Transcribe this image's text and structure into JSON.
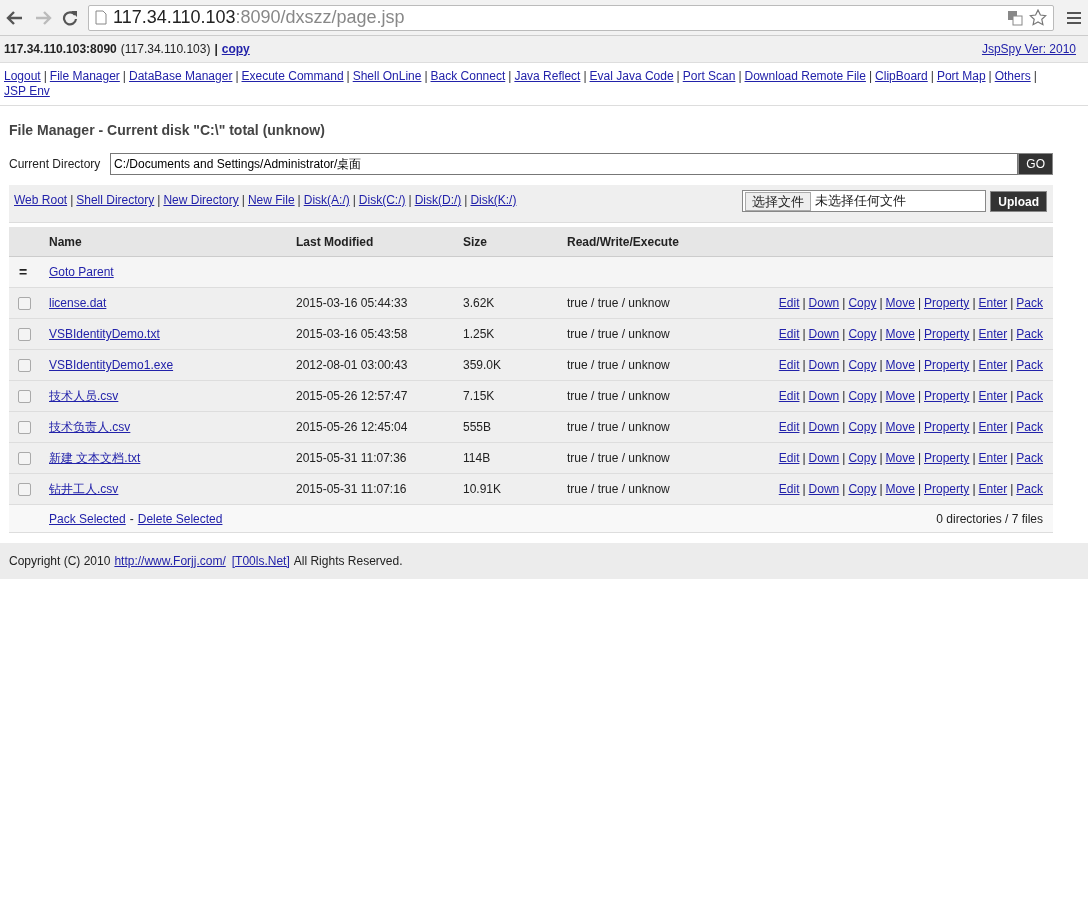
{
  "browser": {
    "url_host": "117.34.110.103",
    "url_rest": ":8090/dxszz/page.jsp"
  },
  "host_bar": {
    "host": "117.34.110.103:8090",
    "ip": "(117.34.110.103)",
    "separator": "|",
    "copy": "copy",
    "version": "JspSpy Ver: 2010"
  },
  "nav": {
    "separator": "|",
    "links": [
      "Logout",
      "File Manager",
      "DataBase Manager",
      "Execute Command",
      "Shell OnLine",
      "Back Connect",
      "Java Reflect",
      "Eval Java Code",
      "Port Scan",
      "Download Remote File",
      "ClipBoard",
      "Port Map",
      "Others",
      "JSP Env"
    ]
  },
  "title": "File Manager - Current disk \"C:\\\" total (unknow)",
  "directory": {
    "label": "Current Directory",
    "value": "C:/Documents and Settings/Administrator/桌面",
    "button": "GO"
  },
  "toolbar": {
    "separator": "|",
    "links": [
      "Web Root",
      "Shell Directory",
      "New Directory",
      "New File",
      "Disk(A:/)",
      "Disk(C:/)",
      "Disk(D:/)",
      "Disk(K:/)"
    ]
  },
  "upload": {
    "choose_button": "选择文件",
    "status": "未选择任何文件",
    "button": "Upload"
  },
  "table": {
    "columns": [
      "Name",
      "Last Modified",
      "Size",
      "Read/Write/Execute"
    ],
    "parent_row": {
      "icon": "=",
      "link": "Goto Parent"
    },
    "action_separator": "|",
    "rows": [
      {
        "checked": false,
        "name": "license.dat",
        "modified": "2015-03-16 05:44:33",
        "size": "3.62K",
        "rwx": "true / true / unknow",
        "actions": [
          "Edit",
          "Down",
          "Copy",
          "Move",
          "Property",
          "Enter",
          "Pack"
        ]
      },
      {
        "checked": false,
        "name": "VSBIdentityDemo.txt",
        "modified": "2015-03-16 05:43:58",
        "size": "1.25K",
        "rwx": "true / true / unknow",
        "actions": [
          "Edit",
          "Down",
          "Copy",
          "Move",
          "Property",
          "Enter",
          "Pack"
        ]
      },
      {
        "checked": false,
        "name": "VSBIdentityDemo1.exe",
        "modified": "2012-08-01 03:00:43",
        "size": "359.0K",
        "rwx": "true / true / unknow",
        "actions": [
          "Edit",
          "Down",
          "Copy",
          "Move",
          "Property",
          "Enter",
          "Pack"
        ]
      },
      {
        "checked": false,
        "name": "技术人员.csv",
        "modified": "2015-05-26 12:57:47",
        "size": "7.15K",
        "rwx": "true / true / unknow",
        "actions": [
          "Edit",
          "Down",
          "Copy",
          "Move",
          "Property",
          "Enter",
          "Pack"
        ]
      },
      {
        "checked": false,
        "name": "技术负责人.csv",
        "modified": "2015-05-26 12:45:04",
        "size": "555B",
        "rwx": "true / true / unknow",
        "actions": [
          "Edit",
          "Down",
          "Copy",
          "Move",
          "Property",
          "Enter",
          "Pack"
        ]
      },
      {
        "checked": false,
        "name": "新建 文本文档.txt",
        "modified": "2015-05-31 11:07:36",
        "size": "114B",
        "rwx": "true / true / unknow",
        "actions": [
          "Edit",
          "Down",
          "Copy",
          "Move",
          "Property",
          "Enter",
          "Pack"
        ]
      },
      {
        "checked": false,
        "name": "钻井工人.csv",
        "modified": "2015-05-31 11:07:16",
        "size": "10.91K",
        "rwx": "true / true / unknow",
        "actions": [
          "Edit",
          "Down",
          "Copy",
          "Move",
          "Property",
          "Enter",
          "Pack"
        ]
      }
    ],
    "footer": {
      "pack": "Pack Selected",
      "separator": "-",
      "delete": "Delete Selected",
      "summary": "0 directories / 7 files"
    }
  },
  "copyright": {
    "prefix": "Copyright (C) 2010",
    "link1": "http://www.Forjj.com/",
    "link2": "[T00ls.Net]",
    "suffix": "All Rights Reserved."
  }
}
